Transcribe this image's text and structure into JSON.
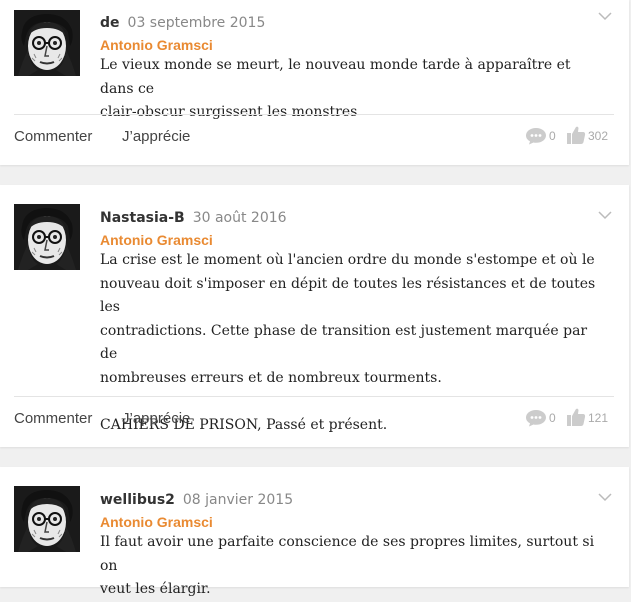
{
  "quotes": [
    {
      "author": "de",
      "date": "03 septembre 2015",
      "source": "Antonio Gramsci",
      "lines": [
        "Le vieux monde se meurt, le nouveau monde tarde à apparaître et dans ce",
        "clair-obscur surgissent les monstres"
      ],
      "comment_label": "Commenter",
      "like_label": "J’apprécie",
      "comments": "0",
      "likes": "302"
    },
    {
      "author": "Nastasia-B",
      "date": "30 août 2016",
      "source": "Antonio Gramsci",
      "lines": [
        "La crise est le moment où l'ancien ordre du monde s'estompe et où le",
        "nouveau doit s'imposer en dépit de toutes les résistances et de toutes les",
        "contradictions. Cette phase de transition est justement marquée par de",
        "nombreuses erreurs et de nombreux tourments.",
        "",
        "CAHIERS DE PRISON, Passé et présent."
      ],
      "comment_label": "Commenter",
      "like_label": "J’apprécie",
      "comments": "0",
      "likes": "121"
    },
    {
      "author": "wellibus2",
      "date": "08 janvier 2015",
      "source": "Antonio Gramsci",
      "lines": [
        "Il faut avoir une parfaite conscience de ses propres limites, surtout si on",
        "veut les élargir."
      ]
    }
  ],
  "icons": {
    "comment": "speech-bubble-icon",
    "like": "thumbs-up-icon",
    "menu": "chevron-down-icon"
  },
  "colors": {
    "source": "#e98a32",
    "background": "#f0f0f0"
  }
}
